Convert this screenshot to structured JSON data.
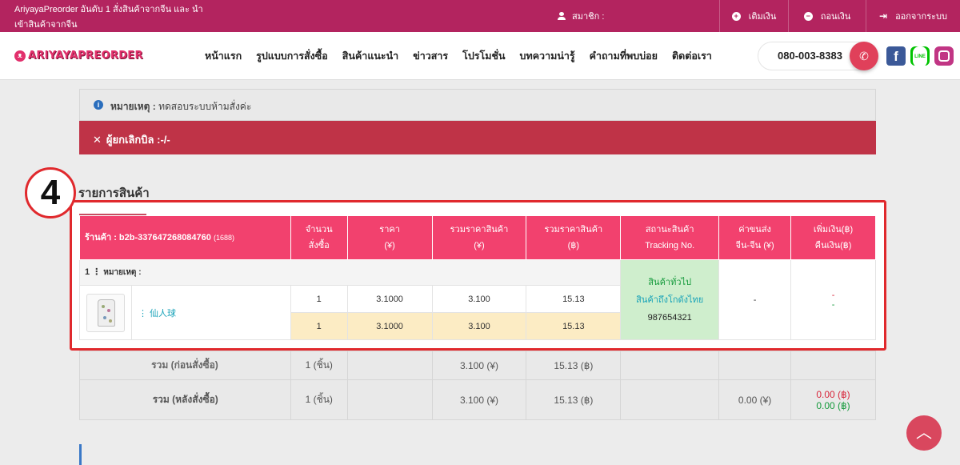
{
  "topbar": {
    "brand_text": "AriyayaPreorder อันดับ 1 สั่งสินค้าจากจีน และ นำเข้าสินค้าจากจีน",
    "member_label": "สมาชิก :",
    "topup_label": "เติมเงิน",
    "withdraw_label": "ถอนเงิน",
    "logout_label": "ออกจากระบบ"
  },
  "nav": {
    "logo": "ARIYAYAPREORDER",
    "items": [
      "หน้าแรก",
      "รูปแบบการสั่งซื้อ",
      "สินค้าแนะนำ",
      "ข่าวสาร",
      "โปรโมชั่น",
      "บทความน่ารู้",
      "คำถามที่พบบ่อย",
      "ติดต่อเรา"
    ],
    "phone": "080-003-8383"
  },
  "note": {
    "label": "หมายเหตุ :",
    "text": "ทดสอบระบบห้ามสั่งค่ะ"
  },
  "cancel": {
    "text": "ผู้ยกเลิกบิล :-/-"
  },
  "step_badge": "4",
  "section_title": "รายการสินค้า",
  "table": {
    "shop_label": "ร้านค้า : b2b-337647268084760",
    "shop_source": "(1688)",
    "headers": {
      "qty": [
        "จำนวน",
        "สั่งซื้อ"
      ],
      "price": [
        "ราคา",
        "(¥)"
      ],
      "total_cny": [
        "รวมราคาสินค้า",
        "(¥)"
      ],
      "total_thb": [
        "รวมราคาสินค้า",
        "(฿)"
      ],
      "status": [
        "สถานะสินค้า",
        "Tracking No."
      ],
      "shipping": [
        "ค่าขนส่ง",
        "จีน-จีน (¥)"
      ],
      "adjust": [
        "เพิ่มเงิน(฿)",
        "คืนเงิน(฿)"
      ]
    },
    "row_note_index": "1",
    "row_note_label": "หมายเหตุ :",
    "product_name": "仙人球",
    "ordered": {
      "qty": "1",
      "price": "3.1000",
      "total_cny": "3.100",
      "total_thb": "15.13"
    },
    "received": {
      "qty": "1",
      "price": "3.1000",
      "total_cny": "3.100",
      "total_thb": "15.13"
    },
    "status_lines": [
      "สินค้าทั่วไป",
      "สินค้าถึงโกดังไทย"
    ],
    "tracking_no": "987654321",
    "shipping_value": "-",
    "add_value": "-",
    "refund_value": "-"
  },
  "summary": {
    "before": {
      "label": "รวม (ก่อนสั่งซื้อ)",
      "qty": "1 (ชิ้น)",
      "total_cny": "3.100 (¥)",
      "total_thb": "15.13 (฿)"
    },
    "after": {
      "label": "รวม (หลังสั่งซื้อ)",
      "qty": "1 (ชิ้น)",
      "total_cny": "3.100 (¥)",
      "total_thb": "15.13 (฿)",
      "shipping": "0.00 (¥)",
      "add": "0.00 (฿)",
      "refund": "0.00 (฿)"
    }
  },
  "colors": {
    "topbar": "#b3245f",
    "table_header": "#f2416e",
    "cancel_bar": "#bf3347",
    "highlight": "#e0292d"
  }
}
